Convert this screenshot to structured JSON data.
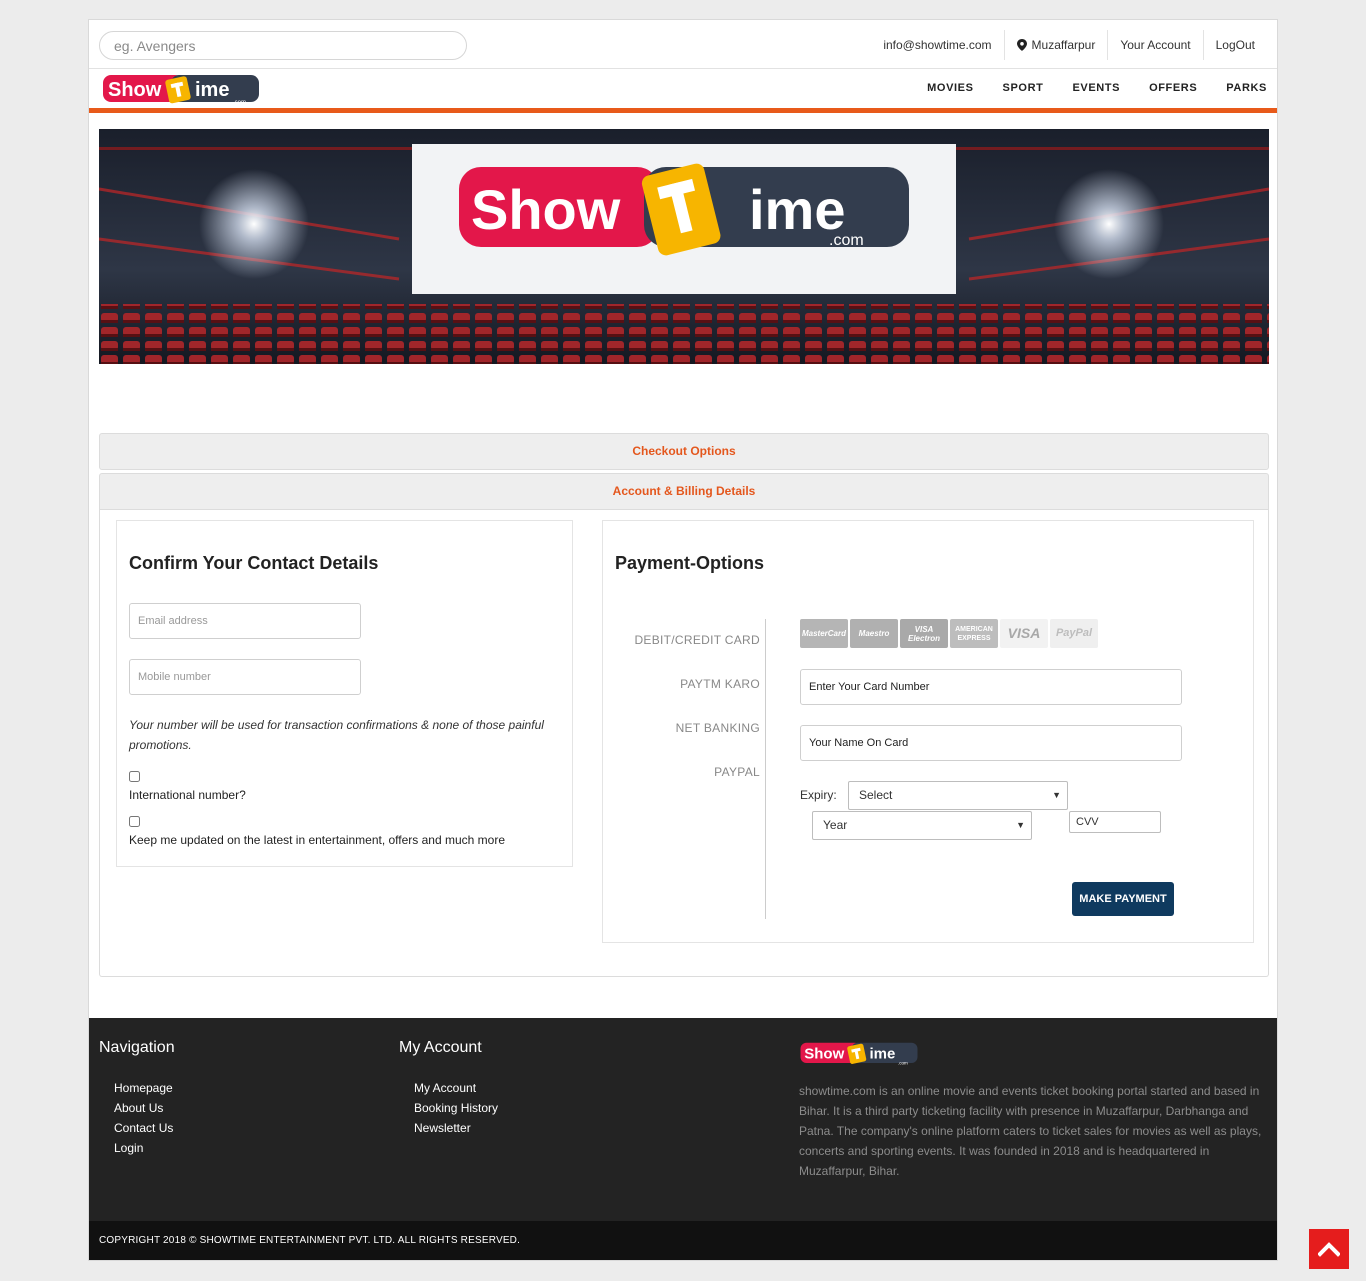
{
  "search": {
    "placeholder": "eg. Avengers"
  },
  "toplinks": {
    "email": "info@showtime.com",
    "location": "Muzaffarpur",
    "account": "Your Account",
    "logout": "LogOut"
  },
  "logo": {
    "show": "Show",
    "ime": "ime",
    "com": ".com"
  },
  "nav": [
    "MOVIES",
    "SPORT",
    "EVENTS",
    "OFFERS",
    "PARKS"
  ],
  "checkout": {
    "tab1": "Checkout Options",
    "tab2": "Account & Billing Details"
  },
  "contact": {
    "title": "Confirm Your Contact Details",
    "email_placeholder": "Email address",
    "mobile_placeholder": "Mobile number",
    "note": "Your number will be used for transaction confirmations & none of those painful promotions.",
    "intl_label": "International number?",
    "updates_label": "Keep me updated on the latest in entertainment, offers and much more"
  },
  "payment": {
    "title": "Payment-Options",
    "tabs": [
      "DEBIT/CREDIT CARD",
      "PAYTM KARO",
      "NET BANKING",
      "PAYPAL"
    ],
    "cards": [
      "MasterCard",
      "Maestro",
      "VISA Electron",
      "AMERICAN EXPRESS",
      "VISA",
      "PayPal"
    ],
    "card_number_placeholder": "Enter Your Card Number",
    "card_name_placeholder": "Your Name On Card",
    "expiry_label": "Expiry:",
    "month_select": "Select",
    "year_select": "Year",
    "cvv_placeholder": "CVV",
    "pay_button": "MAKE PAYMENT"
  },
  "footer": {
    "nav_title": "Navigation",
    "nav_links": [
      "Homepage",
      "About Us",
      "Contact Us",
      "Login"
    ],
    "account_title": "My Account",
    "account_links": [
      "My Account",
      "Booking History",
      "Newsletter"
    ],
    "about": "showtime.com is an online movie and events ticket booking portal started and based in Bihar. It is a third party ticketing facility with presence in Muzaffarpur, Darbhanga and Patna. The company's online platform caters to ticket sales for movies as well as plays, concerts and sporting events. It was founded in 2018 and is headquartered in Muzaffarpur, Bihar.",
    "copyright": "COPYRIGHT 2018 © SHOWTIME ENTERTAINMENT PVT. LTD. ALL RIGHTS RESERVED."
  },
  "colors": {
    "accent": "#e85a1a",
    "brand_red": "#e3174a",
    "brand_yellow": "#f7b500",
    "brand_dark": "#333d4e",
    "pay_button": "#0f3a5f",
    "scroll_top": "#e51d1d"
  },
  "icons": {
    "location": "map-pin-icon",
    "scroll_top": "chevron-up-icon"
  }
}
